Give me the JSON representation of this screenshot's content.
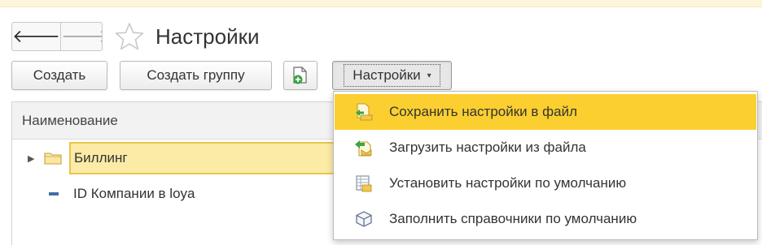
{
  "header": {
    "title": "Настройки",
    "back_glyph": "🡐",
    "forward_glyph": "🡒"
  },
  "toolbar": {
    "create_label": "Создать",
    "create_group_label": "Создать группу",
    "settings_label": "Настройки",
    "settings_caret": "▾"
  },
  "table": {
    "column_header": "Наименование",
    "rows": [
      {
        "name": "Биллинг",
        "type": "folder",
        "expander": "▶"
      },
      {
        "name": "ID Компании в loya",
        "type": "item"
      }
    ]
  },
  "menu": {
    "items": [
      {
        "label": "Сохранить настройки в файл",
        "icon": "save-to-file-icon",
        "active": true
      },
      {
        "label": "Загрузить настройки из файла",
        "icon": "load-from-file-icon",
        "active": false
      },
      {
        "label": "Установить настройки по умолчанию",
        "icon": "default-settings-icon",
        "active": false
      },
      {
        "label": "Заполнить справочники по умолчанию",
        "icon": "fill-catalogs-icon",
        "active": false
      }
    ]
  },
  "colors": {
    "accent_yellow": "#fbcf2f",
    "selection_fill": "#fbeba6",
    "selection_border": "#e9c54c",
    "green_icon": "#3aa642"
  }
}
